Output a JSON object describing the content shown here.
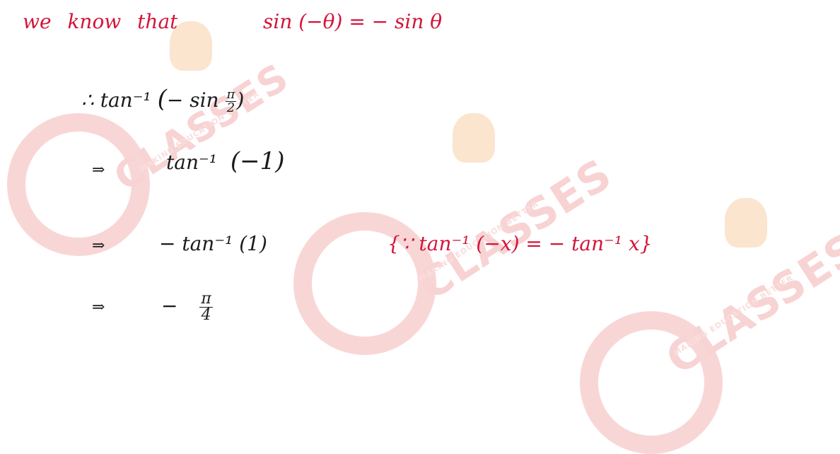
{
  "watermark": {
    "brand": "CLASSES",
    "tagline": "MAKING EDUCATION BETTER"
  },
  "lines": {
    "intro_words": "we know that",
    "identity": "sin (−θ) = − sin θ",
    "step1_prefix": "∴  tan⁻¹",
    "step1_open": "(",
    "step1_body": "− sin ",
    "step1_frac_num": "π",
    "step1_frac_den": "2",
    "step1_close": ")",
    "step2_arrow": "⇒",
    "step2_expr": "tan⁻¹",
    "step2_paren": "(−1)",
    "step3_arrow": "⇒",
    "step3_expr": "− tan⁻¹ (1)",
    "step3_note": "{∵  tan⁻¹ (−x) = − tan⁻¹ x}",
    "step4_arrow": "⇒",
    "step4_minus": "−",
    "step4_frac_num": "π",
    "step4_frac_den": "4"
  },
  "colors": {
    "ink_red": "#d4143a",
    "ink_black": "#1b1b1b",
    "watermark_red": "#f8d3d3",
    "watermark_head": "#fbe5cf"
  }
}
